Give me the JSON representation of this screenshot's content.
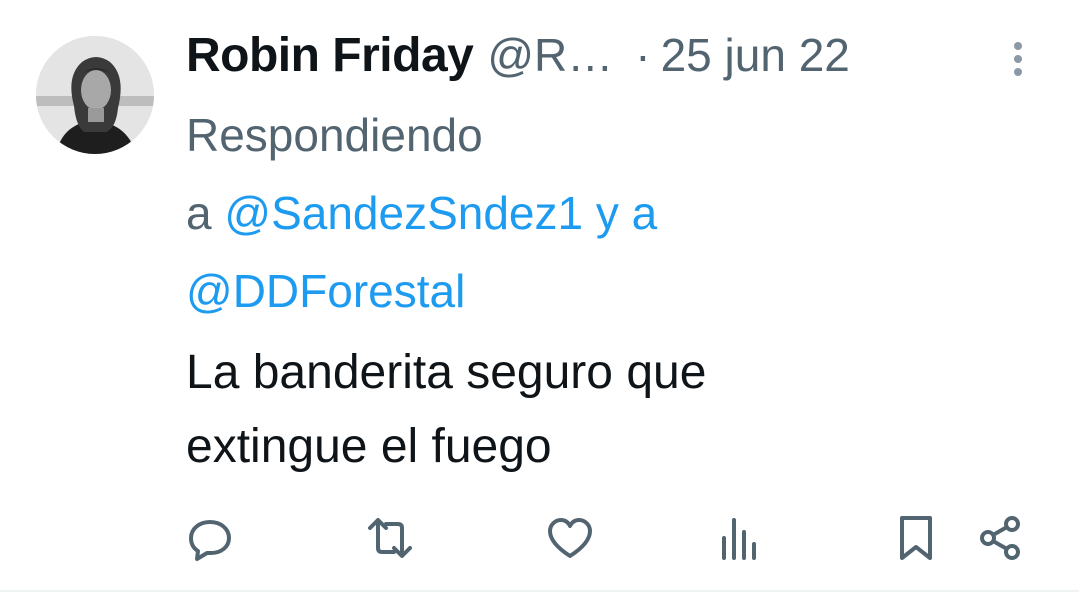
{
  "tweet": {
    "display_name": "Robin Friday",
    "handle": "@R…",
    "separator": "·",
    "date": "25 jun 22",
    "reply_to": {
      "prefix": "Respondiendo",
      "a": "a",
      "mention_1": "@SandezSndez1",
      "connector": "y a",
      "mention_2": "@DDForestal"
    },
    "text_lines": [
      "La banderita seguro que",
      "extingue el fuego"
    ]
  },
  "icons": {
    "avatar": "profile-photo",
    "more": "more-vertical-icon",
    "reply": "reply-icon",
    "retweet": "retweet-icon",
    "like": "heart-icon",
    "views": "views-icon",
    "bookmark": "bookmark-icon",
    "share": "share-icon"
  },
  "colors": {
    "primary_text": "#0f1419",
    "secondary_text": "#536471",
    "link": "#1d9bf0",
    "divider": "#eff3f4"
  }
}
